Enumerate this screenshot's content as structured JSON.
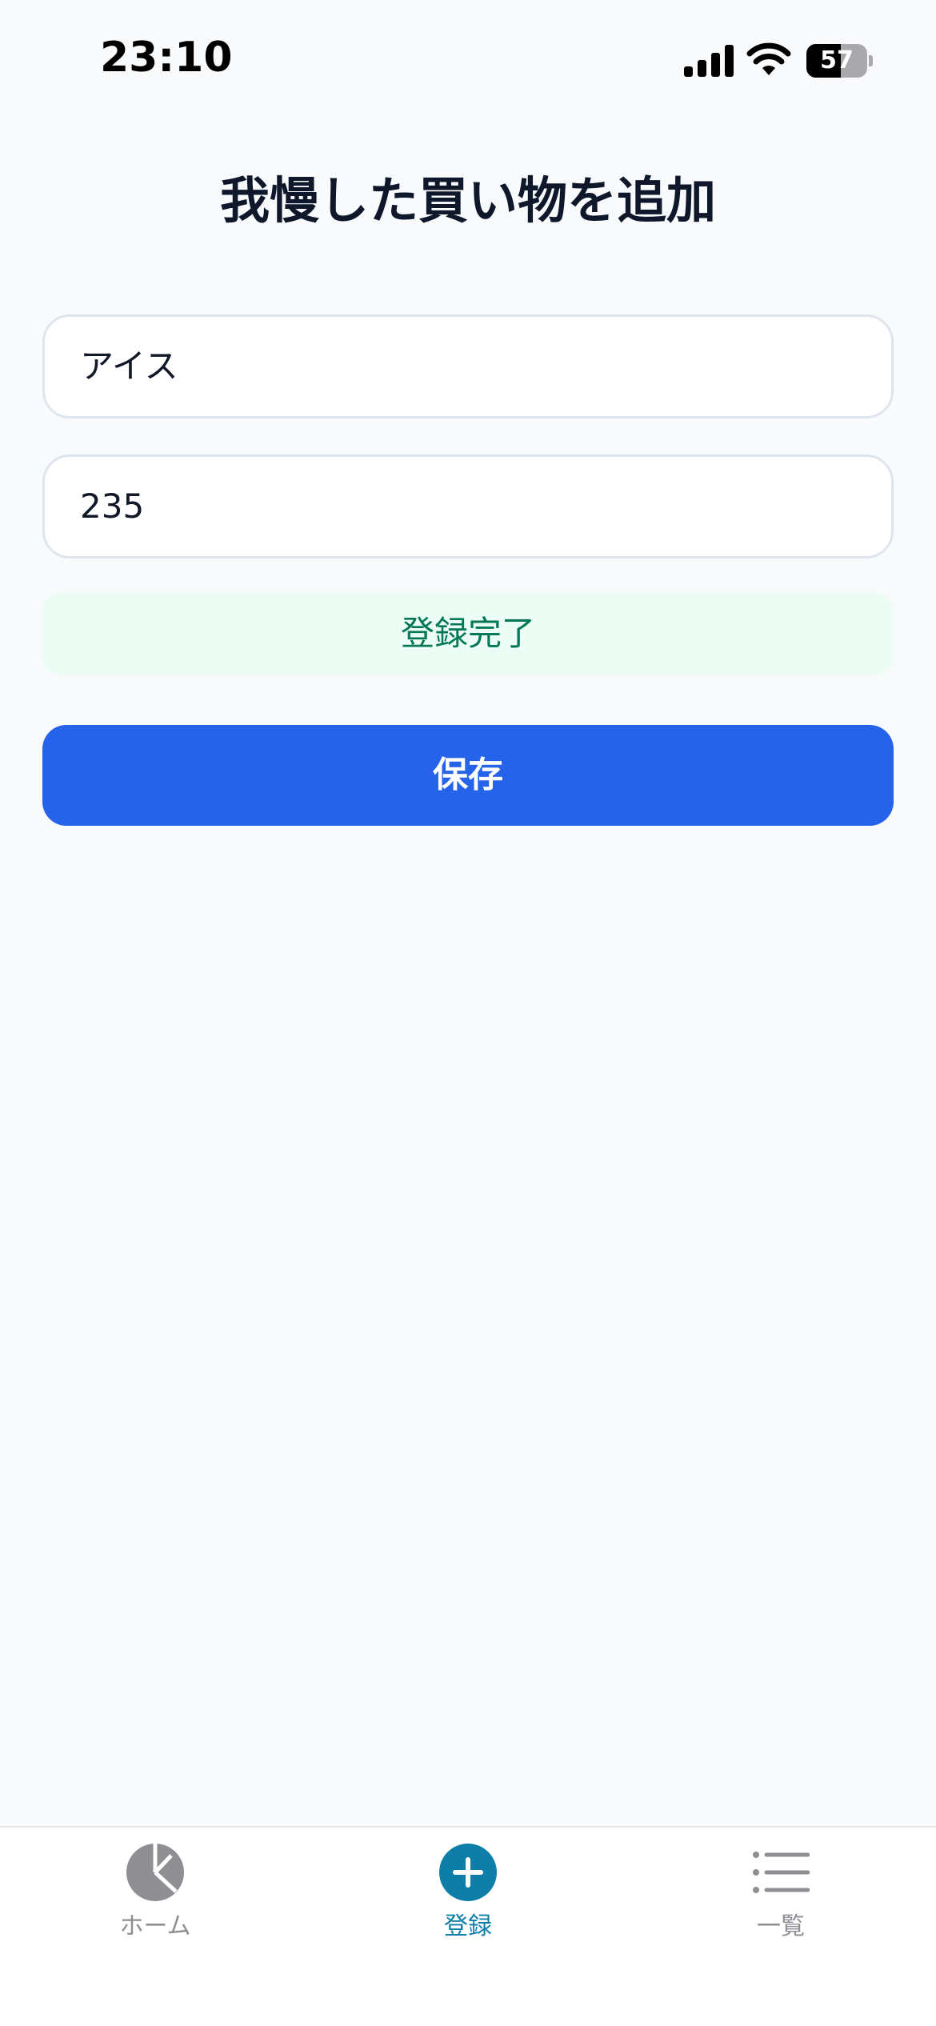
{
  "status_bar": {
    "time": "23:10",
    "battery": "57",
    "battery_level": 0.57,
    "icons": [
      "signal-icon",
      "wifi-icon",
      "battery-icon"
    ]
  },
  "page": {
    "title": "我慢した買い物を追加"
  },
  "form": {
    "item_name_value": "アイス",
    "price_value": "235",
    "success_message": "登録完了",
    "save_label": "保存"
  },
  "tab_bar": {
    "tabs": [
      {
        "label": "ホーム",
        "icon": "pie-chart-icon",
        "active": false
      },
      {
        "label": "登録",
        "icon": "plus-circle-icon",
        "active": true
      },
      {
        "label": "一覧",
        "icon": "list-icon",
        "active": false
      }
    ]
  },
  "colors": {
    "background": "#f8fafc",
    "primary": "#2563eb",
    "success_bg": "#ecfdf5",
    "success_text": "#047857",
    "tab_active": "#0e7ea8",
    "tab_inactive": "#8e8e93"
  }
}
